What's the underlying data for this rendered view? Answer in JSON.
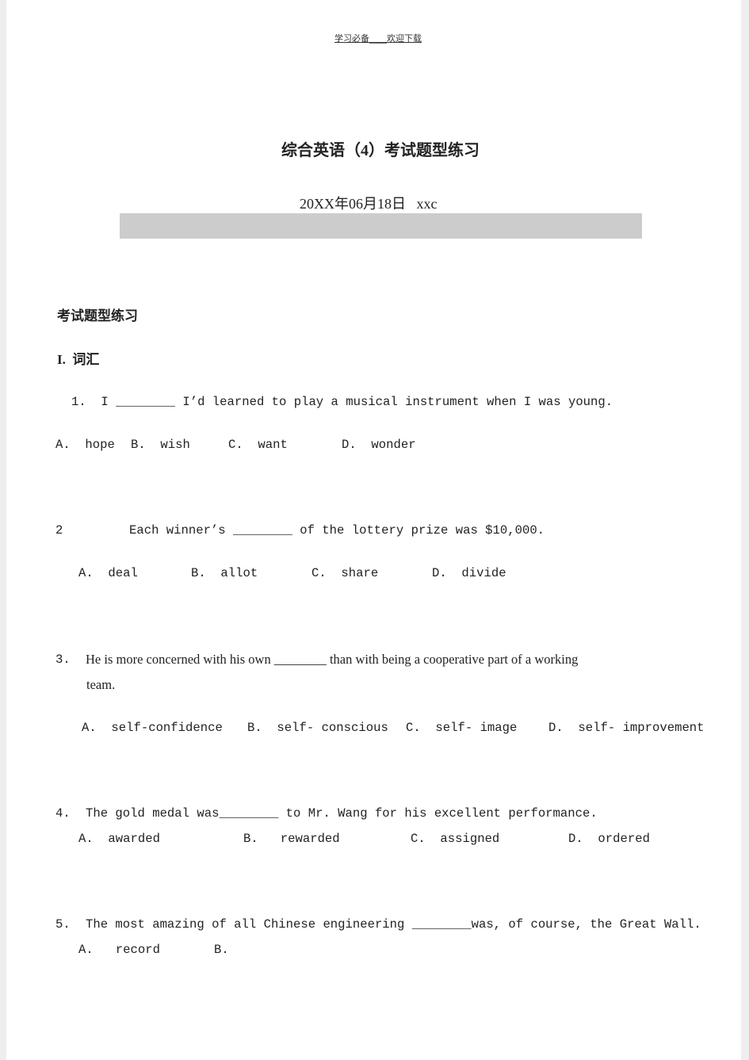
{
  "header": "学习必备____欢迎下载",
  "title": "综合英语（4）考试题型练习",
  "date_line": "20XX年06月18日   xxc",
  "section_title": "考试题型练习",
  "part_heading": "I.  词汇",
  "questions": [
    {
      "stem": "1.  I ________ I’d learned to play a musical instrument when I was young.",
      "options": [
        "A.  hope",
        "B.  wish",
        "C.  want",
        "D.  wonder"
      ]
    },
    {
      "number": "2",
      "stem": "Each winner’s ________ of the lottery prize was $10,000.",
      "options": [
        "A.  deal",
        "B.  allot",
        "C.  share",
        "D.  divide"
      ]
    },
    {
      "number": "3.",
      "stem": "He is more concerned with his own ________ than with being a cooperative part of a working",
      "stem_cont": "team.",
      "options": [
        "A.  self-confidence",
        "B.  self- conscious",
        "C.  self- image",
        "D.  self- improvement"
      ]
    },
    {
      "number": "4.",
      "stem": "The gold medal was________ to Mr. Wang for his excellent performance.",
      "options": [
        "A.  awarded",
        "B.   rewarded",
        "C.  assigned",
        "D.  ordered"
      ]
    },
    {
      "number": "5.",
      "stem": "The most amazing of all Chinese engineering ________was, of course, the Great Wall.",
      "options": [
        "A.   record",
        "B."
      ]
    }
  ]
}
